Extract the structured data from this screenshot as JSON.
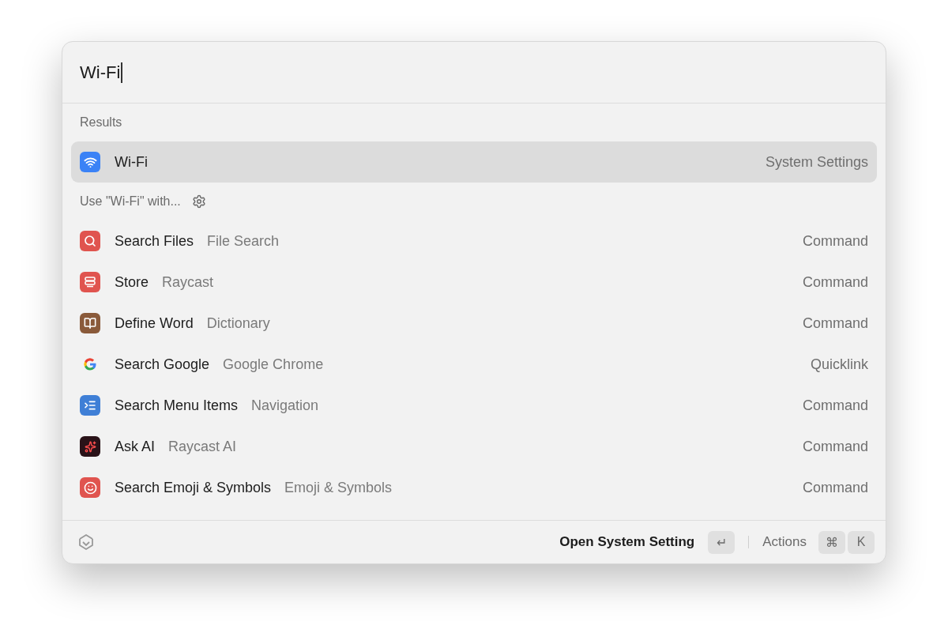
{
  "search": {
    "value": "Wi-Fi"
  },
  "sections": [
    {
      "title": "Results",
      "items": [
        {
          "kind": "wifi",
          "title": "Wi-Fi",
          "accessory": "System Settings",
          "selected": true
        }
      ]
    },
    {
      "title": "Use \"Wi-Fi\" with...",
      "has_settings": true,
      "items": [
        {
          "kind": "search",
          "title": "Search Files",
          "subtitle": "File Search",
          "accessory": "Command",
          "selected": false
        },
        {
          "kind": "store",
          "title": "Store",
          "subtitle": "Raycast",
          "accessory": "Command",
          "selected": false
        },
        {
          "kind": "book",
          "title": "Define Word",
          "subtitle": "Dictionary",
          "accessory": "Command",
          "selected": false
        },
        {
          "kind": "google",
          "title": "Search Google",
          "subtitle": "Google Chrome",
          "accessory": "Quicklink",
          "selected": false
        },
        {
          "kind": "menu",
          "title": "Search Menu Items",
          "subtitle": "Navigation",
          "accessory": "Command",
          "selected": false
        },
        {
          "kind": "ai",
          "title": "Ask AI",
          "subtitle": "Raycast AI",
          "accessory": "Command",
          "selected": false
        },
        {
          "kind": "emoji",
          "title": "Search Emoji & Symbols",
          "subtitle": "Emoji & Symbols",
          "accessory": "Command",
          "selected": false
        }
      ]
    }
  ],
  "footer": {
    "primary_action": "Open System Setting",
    "primary_key": "↵",
    "actions_label": "Actions",
    "action_keys": [
      "⌘",
      "K"
    ]
  }
}
